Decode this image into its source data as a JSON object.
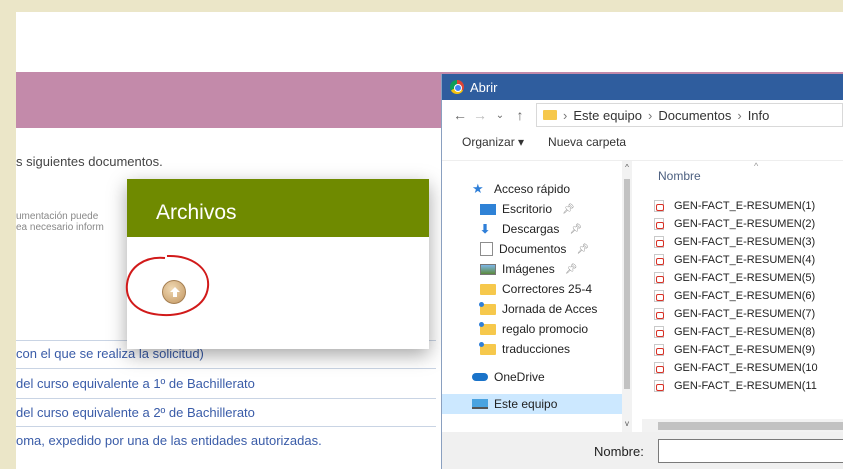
{
  "page": {
    "intro_text": "s siguientes documentos.",
    "note_line1": "umentación puede",
    "note_line2": "ea necesario inform",
    "list_items": [
      "con el que se realiza la solicitud)",
      "del curso equivalente a 1º de Bachillerato",
      "del curso equivalente a 2º de Bachillerato",
      "oma, expedido por una de las entidades autorizadas."
    ]
  },
  "modal": {
    "title": "Archivos",
    "upload_icon": "upload-arrow-icon"
  },
  "dialog": {
    "title": "Abrir",
    "breadcrumb": [
      "Este equipo",
      "Documentos",
      "Info"
    ],
    "toolbar": {
      "organize": "Organizar ▾",
      "new_folder": "Nueva carpeta"
    },
    "nav_items": [
      {
        "label": "Acceso rápido",
        "icon": "star-icon"
      },
      {
        "label": "Escritorio",
        "icon": "desktop-icon",
        "pinned": true
      },
      {
        "label": "Descargas",
        "icon": "download-icon",
        "pinned": true
      },
      {
        "label": "Documentos",
        "icon": "documents-icon",
        "pinned": true
      },
      {
        "label": "Imágenes",
        "icon": "pictures-icon",
        "pinned": true
      },
      {
        "label": "Correctores 25-4",
        "icon": "folder-icon"
      },
      {
        "label": "Jornada de Acces",
        "icon": "folder-icon"
      },
      {
        "label": "regalo promocio",
        "icon": "folder-icon"
      },
      {
        "label": "traducciones",
        "icon": "folder-icon"
      },
      {
        "label": "OneDrive",
        "icon": "onedrive-icon"
      },
      {
        "label": "Este equipo",
        "icon": "this-pc-icon",
        "selected": true
      }
    ],
    "column_header": "Nombre",
    "files": [
      "GEN-FACT_E-RESUMEN(1)",
      "GEN-FACT_E-RESUMEN(2)",
      "GEN-FACT_E-RESUMEN(3)",
      "GEN-FACT_E-RESUMEN(4)",
      "GEN-FACT_E-RESUMEN(5)",
      "GEN-FACT_E-RESUMEN(6)",
      "GEN-FACT_E-RESUMEN(7)",
      "GEN-FACT_E-RESUMEN(8)",
      "GEN-FACT_E-RESUMEN(9)",
      "GEN-FACT_E-RESUMEN(10",
      "GEN-FACT_E-RESUMEN(11"
    ],
    "filename_label": "Nombre:",
    "filename_value": ""
  },
  "colors": {
    "header_purple": "#c38aaa",
    "modal_green": "#6f8a00",
    "dialog_title_blue": "#2f5d9e",
    "annotation_red": "#d11a1a"
  }
}
